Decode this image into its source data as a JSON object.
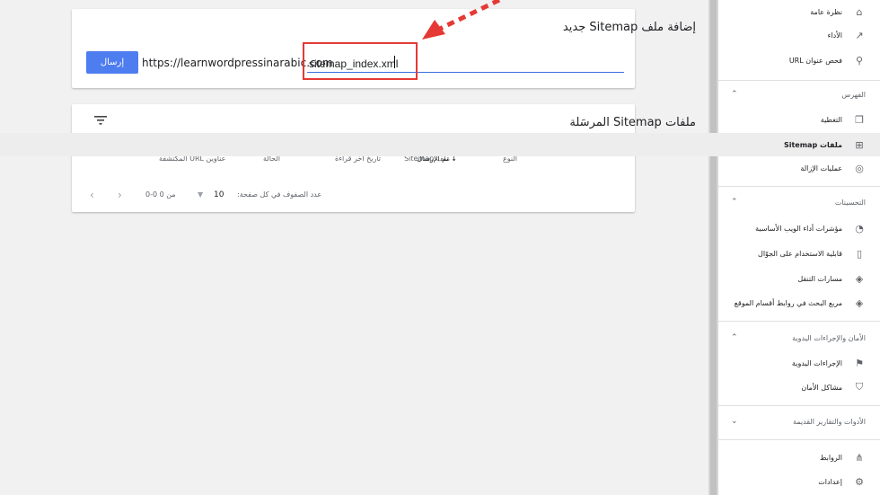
{
  "add_card": {
    "title": "إضافة ملف Sitemap جديد",
    "send_label": "إرسال",
    "url_prefix": "https://learnwordpressinarabic.com",
    "input_value": "sitemap_index.xml"
  },
  "submitted_card": {
    "title": "ملفات Sitemap المرسَلة",
    "columns": [
      "ملف Sitemap",
      "النوع",
      "تم الإرسال",
      "تاريخ آخر قراءة",
      "الحالة",
      "عناوين URL المكتشفة"
    ],
    "rows_per_page_label": "عدد الصفوف في كل صفحة:",
    "rows_per_page_value": "10",
    "range_label": "0-0 من 0"
  },
  "sidebar": {
    "top_items": [
      {
        "label": "نظرة عامة",
        "icon": "home-icon"
      },
      {
        "label": "الأداء",
        "icon": "trend-icon"
      },
      {
        "label": "فحص عنوان URL",
        "icon": "search-icon"
      }
    ],
    "sections": [
      {
        "title": "الفهرس",
        "items": [
          {
            "label": "التغطية",
            "icon": "copy-icon"
          },
          {
            "label": "ملفات Sitemap",
            "icon": "sitemap-icon",
            "active": true
          },
          {
            "label": "عمليات الإزالة",
            "icon": "eye-off-icon"
          }
        ]
      },
      {
        "title": "التحسينات",
        "items": [
          {
            "label": "مؤشرات أداء الويب الأساسية",
            "icon": "gauge-icon"
          },
          {
            "label": "قابلية الاستخدام على الجوّال",
            "icon": "phone-icon"
          },
          {
            "label": "مسارات التنقل",
            "icon": "layers-icon"
          },
          {
            "label": "مربع البحث في روابط أقسام الموقع",
            "icon": "layers-icon"
          }
        ]
      },
      {
        "title": "الأمان والإجراءات اليدوية",
        "items": [
          {
            "label": "الإجراءات اليدوية",
            "icon": "flag-icon"
          },
          {
            "label": "مشاكل الأمان",
            "icon": "shield-icon"
          }
        ]
      },
      {
        "title": "الأدوات والتقارير القديمة",
        "items": []
      }
    ],
    "bottom_items": [
      {
        "label": "الروابط",
        "icon": "network-icon"
      },
      {
        "label": "إعدادات",
        "icon": "gear-icon"
      }
    ]
  },
  "colors": {
    "accent": "#4e7df0",
    "highlight": "#e53935"
  }
}
